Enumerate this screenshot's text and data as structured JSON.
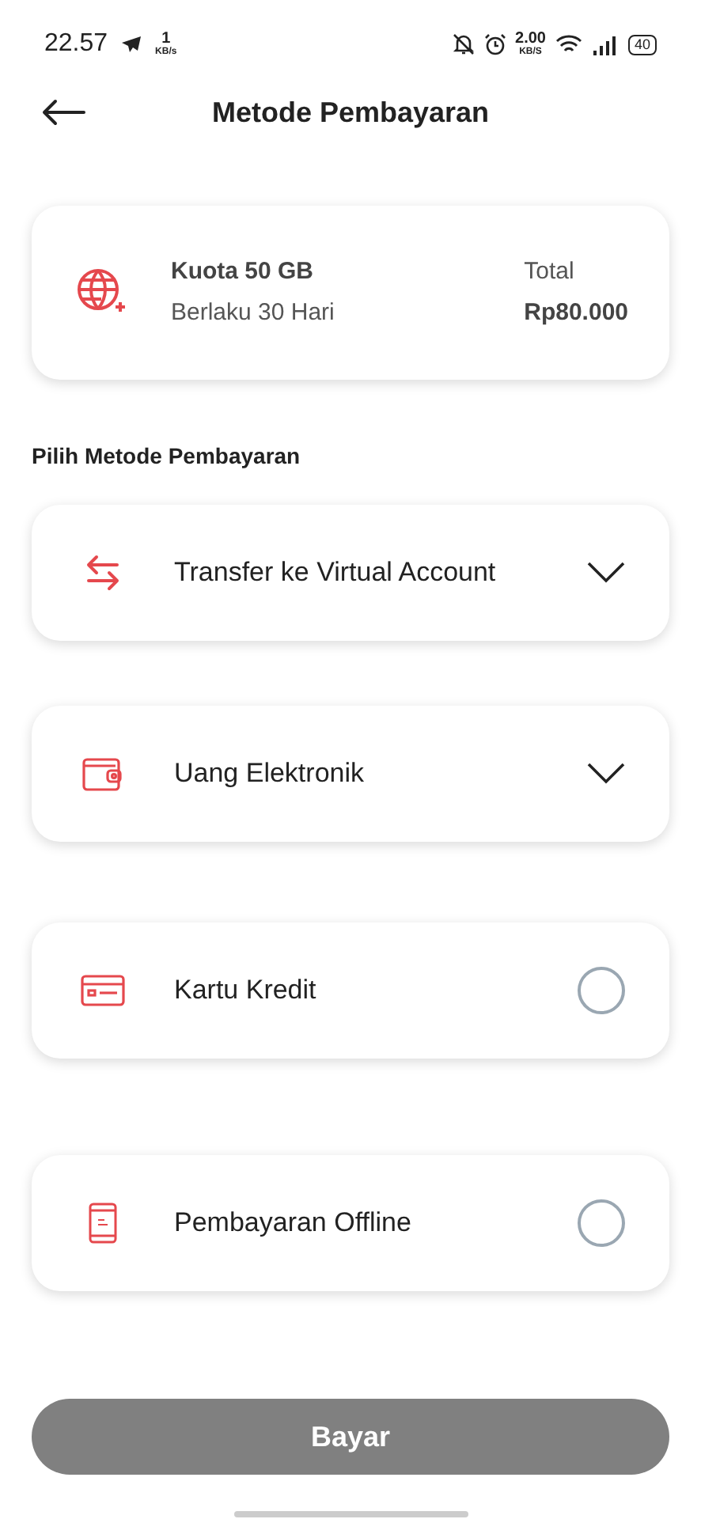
{
  "status_bar": {
    "time": "22.57",
    "net_speed_left": {
      "value": "1",
      "unit": "KB/s"
    },
    "net_speed_right": {
      "value": "2.00",
      "unit": "KB/S"
    },
    "battery": "40"
  },
  "header": {
    "title": "Metode Pembayaran"
  },
  "summary": {
    "product": "Kuota 50 GB",
    "validity": "Berlaku 30 Hari",
    "total_label": "Total",
    "total": "Rp80.000"
  },
  "section_title": "Pilih Metode Pembayaran",
  "methods": [
    {
      "label": "Transfer ke Virtual Account",
      "kind": "expandable",
      "expanded": false
    },
    {
      "label": "Uang Elektronik",
      "kind": "expandable",
      "expanded": false
    },
    {
      "label": "Kartu Kredit",
      "kind": "radio",
      "selected": false
    },
    {
      "label": "Pembayaran Offline",
      "kind": "radio",
      "selected": false
    }
  ],
  "pay_button": {
    "label": "Bayar",
    "disabled": true
  }
}
